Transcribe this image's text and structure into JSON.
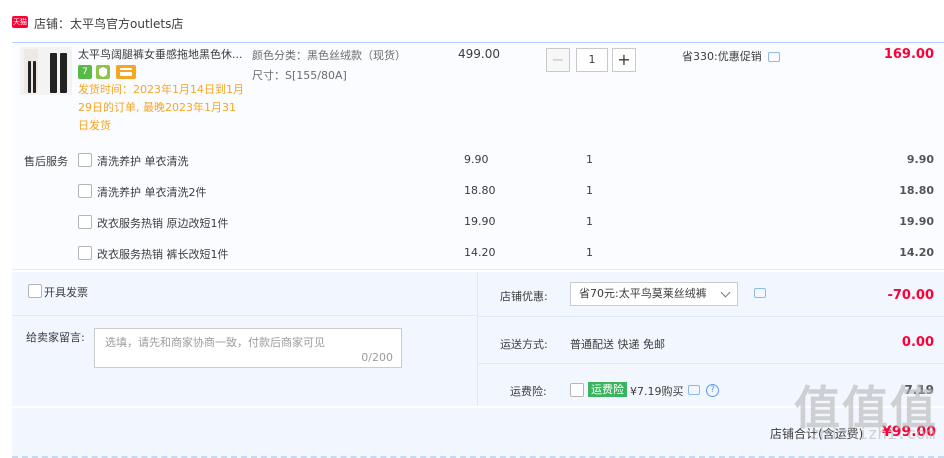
{
  "shop": {
    "logo_text": "天猫",
    "name_label": "店铺：太平鸟官方outlets店"
  },
  "item": {
    "title": "太平鸟阔腿裤女垂感拖地黑色休...",
    "badges": [
      {
        "icon": "seven-day-return-icon",
        "text": "7",
        "color": "#57b946"
      },
      {
        "icon": "shield-icon",
        "text": "",
        "color": "#8dc54b"
      },
      {
        "icon": "card-icon",
        "text": "",
        "color": "#f5a623"
      }
    ],
    "ship_note": "发货时间：2023年1月14日到1月29日的订单, 最晚2023年1月31日发货",
    "spec_color": "颜色分类：黑色丝绒款（现货）",
    "spec_size": "尺寸：S[155/80A]",
    "unit_price": "499.00",
    "quantity": "1",
    "minus": "−",
    "plus": "+",
    "promo": "省330:优惠促销",
    "total": "169.00"
  },
  "services": {
    "label": "售后服务",
    "rows": [
      {
        "name": "清洗养护 单衣清洗",
        "price": "9.90",
        "qty": "1",
        "total": "9.90"
      },
      {
        "name": "清洗养护 单衣清洗2件",
        "price": "18.80",
        "qty": "1",
        "total": "18.80"
      },
      {
        "name": "改衣服务热销 原边改短1件",
        "price": "19.90",
        "qty": "1",
        "total": "19.90"
      },
      {
        "name": "改衣服务热销 裤长改短1件",
        "price": "14.20",
        "qty": "1",
        "total": "14.20"
      }
    ]
  },
  "invoice": {
    "label": "开具发票"
  },
  "message": {
    "label": "给卖家留言:",
    "placeholder": "选填，请先和商家协商一致，付款后商家可见",
    "count": "0/200"
  },
  "shop_discount": {
    "label": "店铺优惠:",
    "selected": "省70元:太平鸟莫莱丝绒裤",
    "value": "-70.00"
  },
  "shipping": {
    "label": "运送方式:",
    "method": "普通配送 快递 免邮",
    "value": "0.00"
  },
  "freight_insurance": {
    "label": "运费险:",
    "tag": "运费险",
    "price_text": "¥7.19购买",
    "value": "7.19"
  },
  "footer": {
    "label": "店铺合计(含运费)",
    "total": "¥99.00"
  },
  "watermark": {
    "glyphs": "值值值",
    "url": "zhizhizhi.com"
  }
}
